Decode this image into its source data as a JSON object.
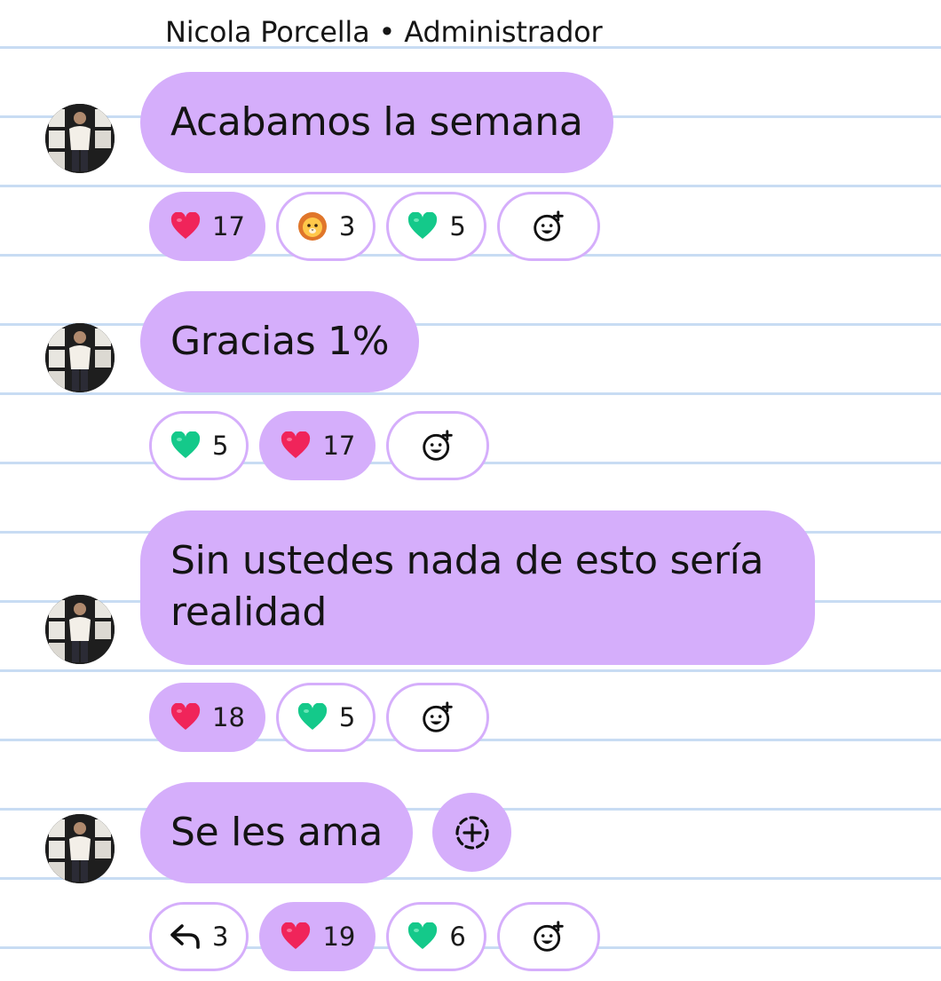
{
  "sender": {
    "name": "Nicola Porcella",
    "role": "Administrador",
    "separator": "•"
  },
  "messages": [
    {
      "text": "Acabamos la semana",
      "reactions": [
        {
          "emoji": "heart-red",
          "count": "17",
          "active": true
        },
        {
          "emoji": "lion",
          "count": "3",
          "active": false
        },
        {
          "emoji": "heart-green",
          "count": "5",
          "active": false
        }
      ]
    },
    {
      "text": "Gracias 1%",
      "reactions": [
        {
          "emoji": "heart-green",
          "count": "5",
          "active": false
        },
        {
          "emoji": "heart-red",
          "count": "17",
          "active": true
        }
      ]
    },
    {
      "text": "Sin ustedes nada de esto sería realidad",
      "reactions": [
        {
          "emoji": "heart-red",
          "count": "18",
          "active": true
        },
        {
          "emoji": "heart-green",
          "count": "5",
          "active": false
        }
      ]
    },
    {
      "text": "Se les ama",
      "reactions": [
        {
          "emoji": "reply-arrow",
          "count": "3",
          "active": false
        },
        {
          "emoji": "heart-red",
          "count": "19",
          "active": true
        },
        {
          "emoji": "heart-green",
          "count": "6",
          "active": false
        }
      ]
    }
  ],
  "colors": {
    "bubble": "#d5aefb",
    "ruled_line": "#c8dcf3",
    "heart_red": "#f0245a",
    "heart_green": "#14c98a"
  }
}
